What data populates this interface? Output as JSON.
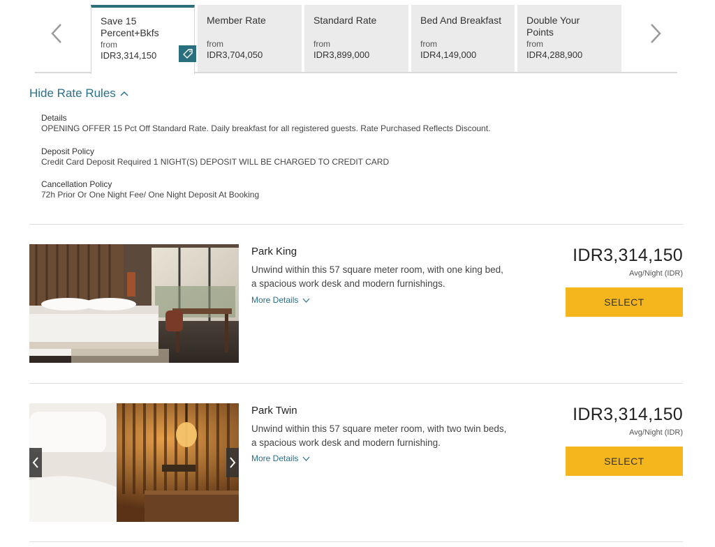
{
  "rate_tabs": {
    "items": [
      {
        "name": "Save 15 Percent+Bkfs",
        "from": "from",
        "price": "IDR3,314,150",
        "active": true
      },
      {
        "name": "Member Rate",
        "from": "from",
        "price": "IDR3,704,050",
        "active": false
      },
      {
        "name": "Standard Rate",
        "from": "from",
        "price": "IDR3,899,000",
        "active": false
      },
      {
        "name": "Bed And Breakfast",
        "from": "from",
        "price": "IDR4,149,000",
        "active": false
      },
      {
        "name": "Double Your Points",
        "from": "from",
        "price": "IDR4,288,900",
        "active": false
      }
    ],
    "prev_icon": "chevron-left-icon",
    "next_icon": "chevron-right-icon",
    "badge_icon": "price-tag-icon",
    "accent_color": "#2a6f7d"
  },
  "rate_rules": {
    "toggle_label": "Hide Rate Rules",
    "toggle_icon": "chevron-up-icon",
    "details_title": "Details",
    "details_text": "OPENING OFFER 15 Pct Off Standard Rate. Daily breakfast for all registered guests. Rate Purchased Reflects Discount.",
    "deposit_title": "Deposit Policy",
    "deposit_text": "Credit Card Deposit Required 1 NIGHT(S) DEPOSIT WILL BE CHARGED TO CREDIT CARD",
    "cancellation_title": "Cancellation Policy",
    "cancellation_text": "72h Prior Or One Night Fee/ One Night Deposit At Booking"
  },
  "rooms": [
    {
      "name": "Park King",
      "description": "Unwind within this 57 square meter room, with one king bed, a spacious work desk and modern furnishings.",
      "more_label": "More Details",
      "price": "IDR3,314,150",
      "price_caption": "Avg/Night (IDR)",
      "select_label": "SELECT"
    },
    {
      "name": "Park Twin",
      "description": "Unwind within this 57 square meter room, with two twin beds, a spacious work desk and modern furnishing.",
      "more_label": "More Details",
      "price": "IDR3,314,150",
      "price_caption": "Avg/Night (IDR)",
      "select_label": "SELECT"
    }
  ],
  "colors": {
    "accent_teal": "#2a6f7d",
    "link_blue": "#2a6f8b",
    "select_yellow": "#f5b51c",
    "tab_grey": "#ebebeb"
  }
}
